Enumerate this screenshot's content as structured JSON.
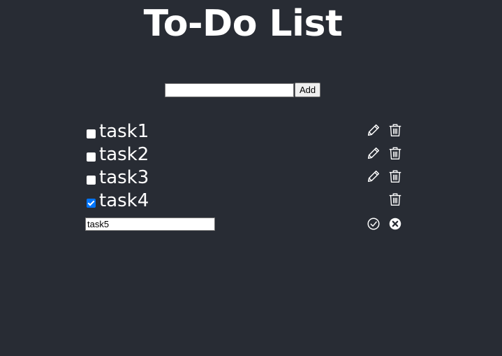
{
  "header": {
    "title": "To-Do List"
  },
  "add_form": {
    "input_value": "",
    "add_label": "Add"
  },
  "tasks": [
    {
      "label": "task1",
      "checked": false
    },
    {
      "label": "task2",
      "checked": false
    },
    {
      "label": "task3",
      "checked": false
    },
    {
      "label": "task4",
      "checked": true
    }
  ],
  "editing_task": {
    "input_value": "task5"
  },
  "icons": {
    "edit": "pencil-icon",
    "delete": "trash-icon",
    "confirm": "check-circle-icon",
    "cancel": "x-circle-icon"
  },
  "colors": {
    "background": "#282c34",
    "text": "#ffffff",
    "checkbox_checked": "#0075ff"
  }
}
